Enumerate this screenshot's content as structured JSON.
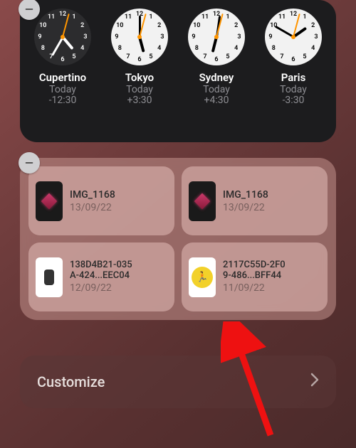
{
  "worldclock": {
    "cities": [
      {
        "name": "Cupertino",
        "day": "Today",
        "offset": "-12:30",
        "face": "dark",
        "hr": 140,
        "mn": 210,
        "sc": 15
      },
      {
        "name": "Tokyo",
        "day": "Today",
        "offset": "+3:30",
        "face": "light",
        "hr": 165,
        "mn": 0,
        "sc": 15
      },
      {
        "name": "Sydney",
        "day": "Today",
        "offset": "+4:30",
        "face": "light",
        "hr": 194,
        "mn": 8,
        "sc": 15
      },
      {
        "name": "Paris",
        "day": "Today",
        "offset": "-3:30",
        "face": "light",
        "hr": 55,
        "mn": 300,
        "sc": 15
      }
    ]
  },
  "files": {
    "items": [
      {
        "thumb": "gem",
        "name": "IMG_1168",
        "date": "13/09/22"
      },
      {
        "thumb": "gem",
        "name": "IMG_1168",
        "date": "13/09/22"
      },
      {
        "thumb": "earbud",
        "name_l1": "138D4B21-035",
        "name_l2": "A-424...EEC04",
        "date": "12/09/22"
      },
      {
        "thumb": "runner",
        "name_l1": "2117C55D-2F0",
        "name_l2": "9-486...BFF44",
        "date": "11/09/22"
      }
    ]
  },
  "customize": {
    "label": "Customize"
  },
  "remove_glyph": "−"
}
